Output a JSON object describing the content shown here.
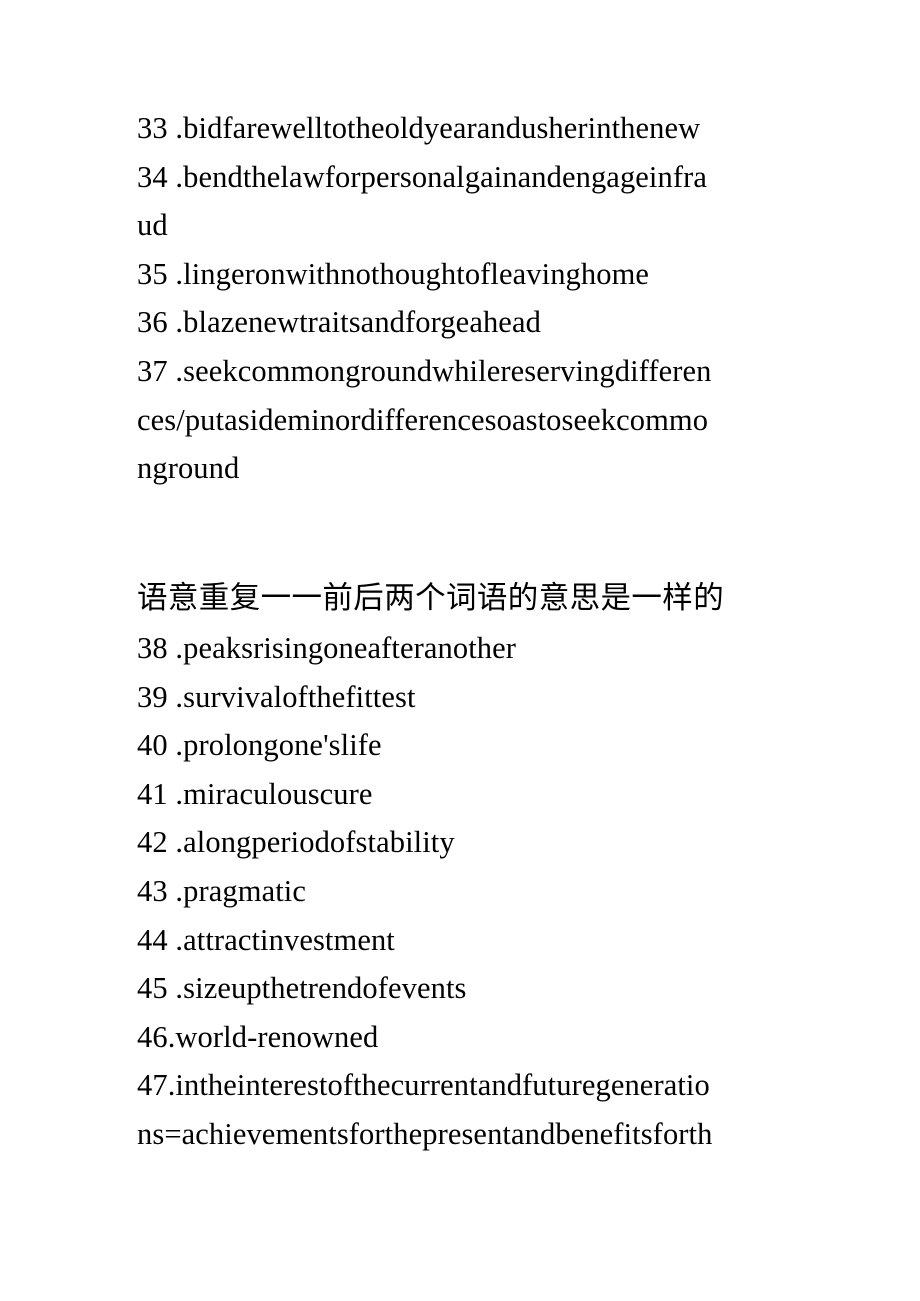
{
  "document": {
    "page_background": "#ffffff",
    "text_color": "#000000",
    "lines": [
      {
        "id": "entry-33",
        "text": "33 .bidfarewelltotheoldyearandusherinthenew"
      },
      {
        "id": "entry-34",
        "text": "34 .bendthelawforpersonalgainandengageinfra"
      },
      {
        "id": "entry-34-cont",
        "text": "ud"
      },
      {
        "id": "entry-35",
        "text": "35 .lingeronwithnothoughtofleavinghome"
      },
      {
        "id": "entry-36",
        "text": "36 .blazenewtraitsandforgeahead"
      },
      {
        "id": "entry-37",
        "text": "37 .seekcommongroundwhilereservingdifferen"
      },
      {
        "id": "entry-37-cont-1",
        "text": "ces/putasideminordifferencesoastoseekcommo"
      },
      {
        "id": "entry-37-cont-2",
        "text": "nground"
      }
    ],
    "section_heading": "语意重复一一前后两个词语的意思是一样的",
    "lines_after_heading": [
      {
        "id": "entry-38",
        "text": "38 .peaksrisingoneafteranother"
      },
      {
        "id": "entry-39",
        "text": "39 .survivalofthefittest"
      },
      {
        "id": "entry-40",
        "text": "40 .prolongone'slife"
      },
      {
        "id": "entry-41",
        "text": "41 .miraculouscure"
      },
      {
        "id": "entry-42",
        "text": "42 .alongperiodofstability"
      },
      {
        "id": "entry-43",
        "text": "43 .pragmatic"
      },
      {
        "id": "entry-44",
        "text": "44 .attractinvestment"
      },
      {
        "id": "entry-45",
        "text": "45 .sizeupthetrendofevents"
      },
      {
        "id": "entry-46",
        "text": "46.world-renowned"
      },
      {
        "id": "entry-47",
        "text": "47.intheinterestofthecurrentandfuturegeneratio"
      },
      {
        "id": "entry-47-cont",
        "text": "ns=achievementsforthepresentandbenefitsforth"
      }
    ]
  }
}
